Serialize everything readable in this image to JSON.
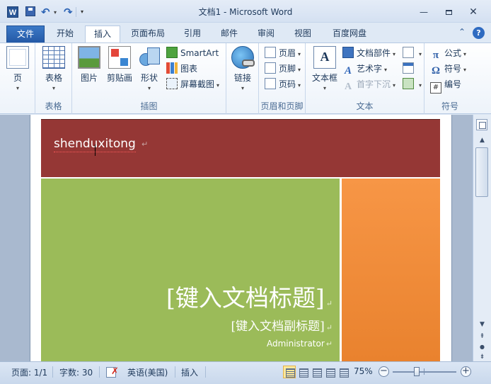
{
  "app": {
    "title": "文档1 - Microsoft Word",
    "icon_letter": "W"
  },
  "quick_access": {
    "save_icon": "save-icon",
    "undo_glyph": "↶",
    "redo_glyph": "↷"
  },
  "window_controls": {
    "minimize": "—",
    "close": "✕"
  },
  "tabs": [
    {
      "label": "文件"
    },
    {
      "label": "开始"
    },
    {
      "label": "插入",
      "active": true
    },
    {
      "label": "页面布局"
    },
    {
      "label": "引用"
    },
    {
      "label": "邮件"
    },
    {
      "label": "审阅"
    },
    {
      "label": "视图"
    },
    {
      "label": "百度网盘"
    }
  ],
  "help": {
    "minimize_glyph": "⌃",
    "help_glyph": "?"
  },
  "ribbon": {
    "groups": {
      "pages": {
        "label": "",
        "page_btn": "页"
      },
      "tables": {
        "label": "表格",
        "table_btn": "表格"
      },
      "illustrations": {
        "label": "插图",
        "picture": "图片",
        "clipart": "剪贴画",
        "shapes": "形状",
        "smartart": "SmartArt",
        "chart": "图表",
        "screenshot": "屏幕截图"
      },
      "links": {
        "label": "",
        "link_btn": "链接"
      },
      "header_footer": {
        "label": "页眉和页脚",
        "header": "页眉",
        "footer": "页脚",
        "page_number": "页码"
      },
      "text": {
        "label": "文本",
        "textbox": "文本框",
        "quick_parts": "文档部件",
        "wordart": "艺术字",
        "dropcap": "首字下沉"
      },
      "symbols": {
        "label": "符号",
        "equation": "公式",
        "symbol": "符号",
        "numbering": "编号",
        "equation_glyph": "π",
        "symbol_glyph": "Ω"
      }
    }
  },
  "document": {
    "header_text": "shenduxitong",
    "title_placeholder": "[键入文档标题]",
    "subtitle_placeholder": "[键入文档副标题]",
    "author": "Administrator",
    "para_mark": "↵",
    "colors": {
      "top_band": "#953735",
      "green_panel": "#9bbb59",
      "orange_panel": "#f79646"
    }
  },
  "statusbar": {
    "page": "页面: 1/1",
    "words": "字数: 30",
    "language": "英语(美国)",
    "mode": "插入",
    "zoom": "75%",
    "zoom_minus": "−",
    "zoom_plus": "+"
  }
}
